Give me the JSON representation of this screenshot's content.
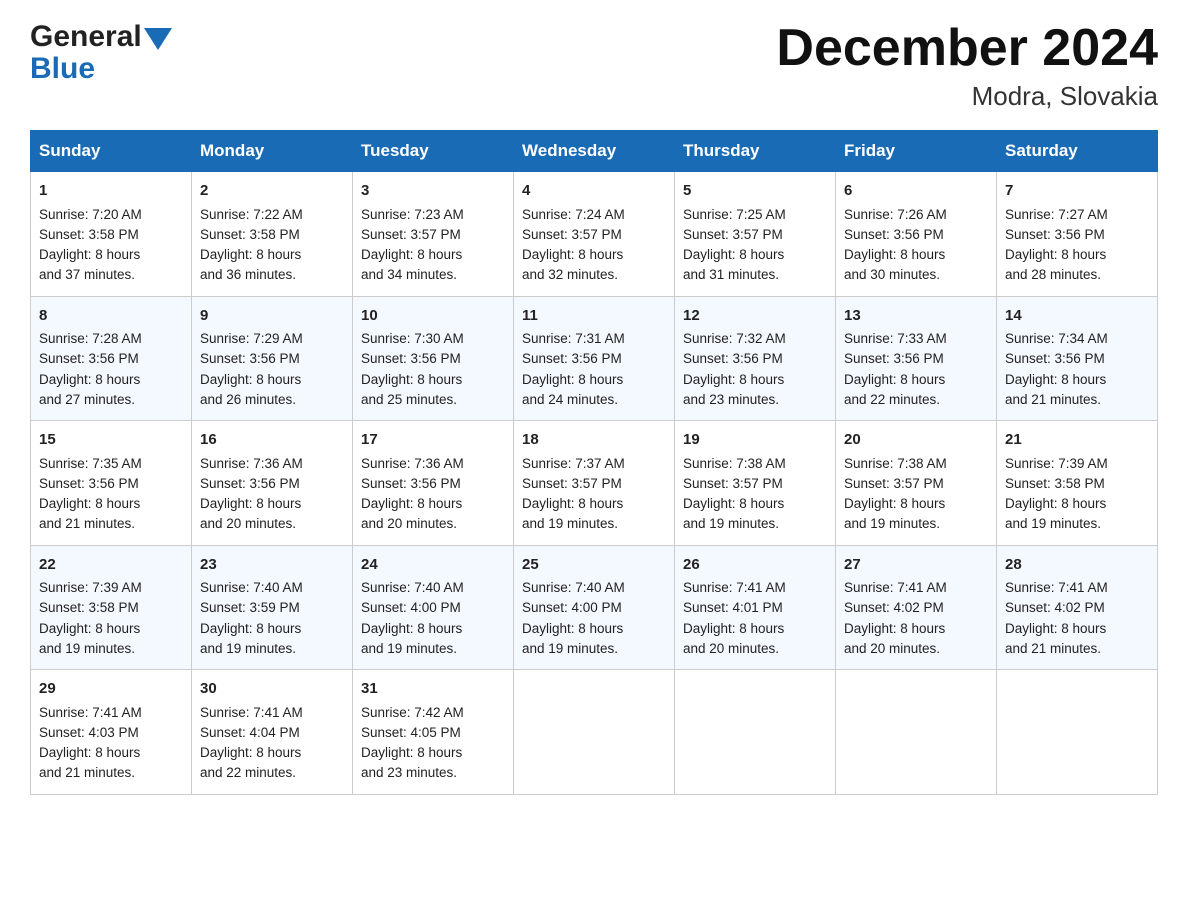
{
  "header": {
    "title": "December 2024",
    "location": "Modra, Slovakia",
    "logo_general": "General",
    "logo_blue": "Blue"
  },
  "days_of_week": [
    "Sunday",
    "Monday",
    "Tuesday",
    "Wednesday",
    "Thursday",
    "Friday",
    "Saturday"
  ],
  "weeks": [
    [
      {
        "day": 1,
        "sunrise": "7:20 AM",
        "sunset": "3:58 PM",
        "daylight": "8 hours and 37 minutes."
      },
      {
        "day": 2,
        "sunrise": "7:22 AM",
        "sunset": "3:58 PM",
        "daylight": "8 hours and 36 minutes."
      },
      {
        "day": 3,
        "sunrise": "7:23 AM",
        "sunset": "3:57 PM",
        "daylight": "8 hours and 34 minutes."
      },
      {
        "day": 4,
        "sunrise": "7:24 AM",
        "sunset": "3:57 PM",
        "daylight": "8 hours and 32 minutes."
      },
      {
        "day": 5,
        "sunrise": "7:25 AM",
        "sunset": "3:57 PM",
        "daylight": "8 hours and 31 minutes."
      },
      {
        "day": 6,
        "sunrise": "7:26 AM",
        "sunset": "3:56 PM",
        "daylight": "8 hours and 30 minutes."
      },
      {
        "day": 7,
        "sunrise": "7:27 AM",
        "sunset": "3:56 PM",
        "daylight": "8 hours and 28 minutes."
      }
    ],
    [
      {
        "day": 8,
        "sunrise": "7:28 AM",
        "sunset": "3:56 PM",
        "daylight": "8 hours and 27 minutes."
      },
      {
        "day": 9,
        "sunrise": "7:29 AM",
        "sunset": "3:56 PM",
        "daylight": "8 hours and 26 minutes."
      },
      {
        "day": 10,
        "sunrise": "7:30 AM",
        "sunset": "3:56 PM",
        "daylight": "8 hours and 25 minutes."
      },
      {
        "day": 11,
        "sunrise": "7:31 AM",
        "sunset": "3:56 PM",
        "daylight": "8 hours and 24 minutes."
      },
      {
        "day": 12,
        "sunrise": "7:32 AM",
        "sunset": "3:56 PM",
        "daylight": "8 hours and 23 minutes."
      },
      {
        "day": 13,
        "sunrise": "7:33 AM",
        "sunset": "3:56 PM",
        "daylight": "8 hours and 22 minutes."
      },
      {
        "day": 14,
        "sunrise": "7:34 AM",
        "sunset": "3:56 PM",
        "daylight": "8 hours and 21 minutes."
      }
    ],
    [
      {
        "day": 15,
        "sunrise": "7:35 AM",
        "sunset": "3:56 PM",
        "daylight": "8 hours and 21 minutes."
      },
      {
        "day": 16,
        "sunrise": "7:36 AM",
        "sunset": "3:56 PM",
        "daylight": "8 hours and 20 minutes."
      },
      {
        "day": 17,
        "sunrise": "7:36 AM",
        "sunset": "3:56 PM",
        "daylight": "8 hours and 20 minutes."
      },
      {
        "day": 18,
        "sunrise": "7:37 AM",
        "sunset": "3:57 PM",
        "daylight": "8 hours and 19 minutes."
      },
      {
        "day": 19,
        "sunrise": "7:38 AM",
        "sunset": "3:57 PM",
        "daylight": "8 hours and 19 minutes."
      },
      {
        "day": 20,
        "sunrise": "7:38 AM",
        "sunset": "3:57 PM",
        "daylight": "8 hours and 19 minutes."
      },
      {
        "day": 21,
        "sunrise": "7:39 AM",
        "sunset": "3:58 PM",
        "daylight": "8 hours and 19 minutes."
      }
    ],
    [
      {
        "day": 22,
        "sunrise": "7:39 AM",
        "sunset": "3:58 PM",
        "daylight": "8 hours and 19 minutes."
      },
      {
        "day": 23,
        "sunrise": "7:40 AM",
        "sunset": "3:59 PM",
        "daylight": "8 hours and 19 minutes."
      },
      {
        "day": 24,
        "sunrise": "7:40 AM",
        "sunset": "4:00 PM",
        "daylight": "8 hours and 19 minutes."
      },
      {
        "day": 25,
        "sunrise": "7:40 AM",
        "sunset": "4:00 PM",
        "daylight": "8 hours and 19 minutes."
      },
      {
        "day": 26,
        "sunrise": "7:41 AM",
        "sunset": "4:01 PM",
        "daylight": "8 hours and 20 minutes."
      },
      {
        "day": 27,
        "sunrise": "7:41 AM",
        "sunset": "4:02 PM",
        "daylight": "8 hours and 20 minutes."
      },
      {
        "day": 28,
        "sunrise": "7:41 AM",
        "sunset": "4:02 PM",
        "daylight": "8 hours and 21 minutes."
      }
    ],
    [
      {
        "day": 29,
        "sunrise": "7:41 AM",
        "sunset": "4:03 PM",
        "daylight": "8 hours and 21 minutes."
      },
      {
        "day": 30,
        "sunrise": "7:41 AM",
        "sunset": "4:04 PM",
        "daylight": "8 hours and 22 minutes."
      },
      {
        "day": 31,
        "sunrise": "7:42 AM",
        "sunset": "4:05 PM",
        "daylight": "8 hours and 23 minutes."
      },
      null,
      null,
      null,
      null
    ]
  ],
  "labels": {
    "sunrise": "Sunrise:",
    "sunset": "Sunset:",
    "daylight": "Daylight:"
  }
}
